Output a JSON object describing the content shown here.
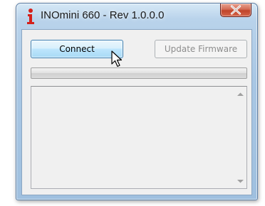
{
  "window": {
    "title": "INOmini 660 - Rev 1.0.0.0",
    "app_icon": "info-i-icon",
    "close_icon": "close-icon",
    "close_color": "#c7452d"
  },
  "toolbar": {
    "connect_label": "Connect",
    "update_label": "Update Firmware",
    "update_enabled": false
  },
  "progress": {
    "value": 0
  },
  "log": {
    "text": "",
    "scroll_up_icon": "chevron-up-icon",
    "scroll_down_icon": "chevron-down-icon"
  },
  "cursor": {
    "icon": "arrow-pointer-icon"
  }
}
